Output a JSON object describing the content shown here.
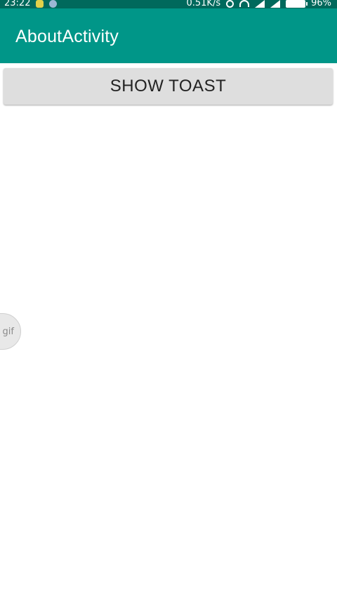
{
  "status_bar": {
    "time": "23:22",
    "network_speed": "0.51K/s",
    "battery": "96%",
    "icons": [
      "notification-icon",
      "notification-icon-alt",
      "alarm-icon",
      "wifi-icon",
      "signal-icon",
      "signal-icon",
      "battery-icon"
    ]
  },
  "app_bar": {
    "title": "AboutActivity",
    "color": "#009688",
    "status_color": "#00695c"
  },
  "main": {
    "show_toast_label": "SHOW TOAST"
  },
  "overlay": {
    "gif_label": "gif"
  }
}
